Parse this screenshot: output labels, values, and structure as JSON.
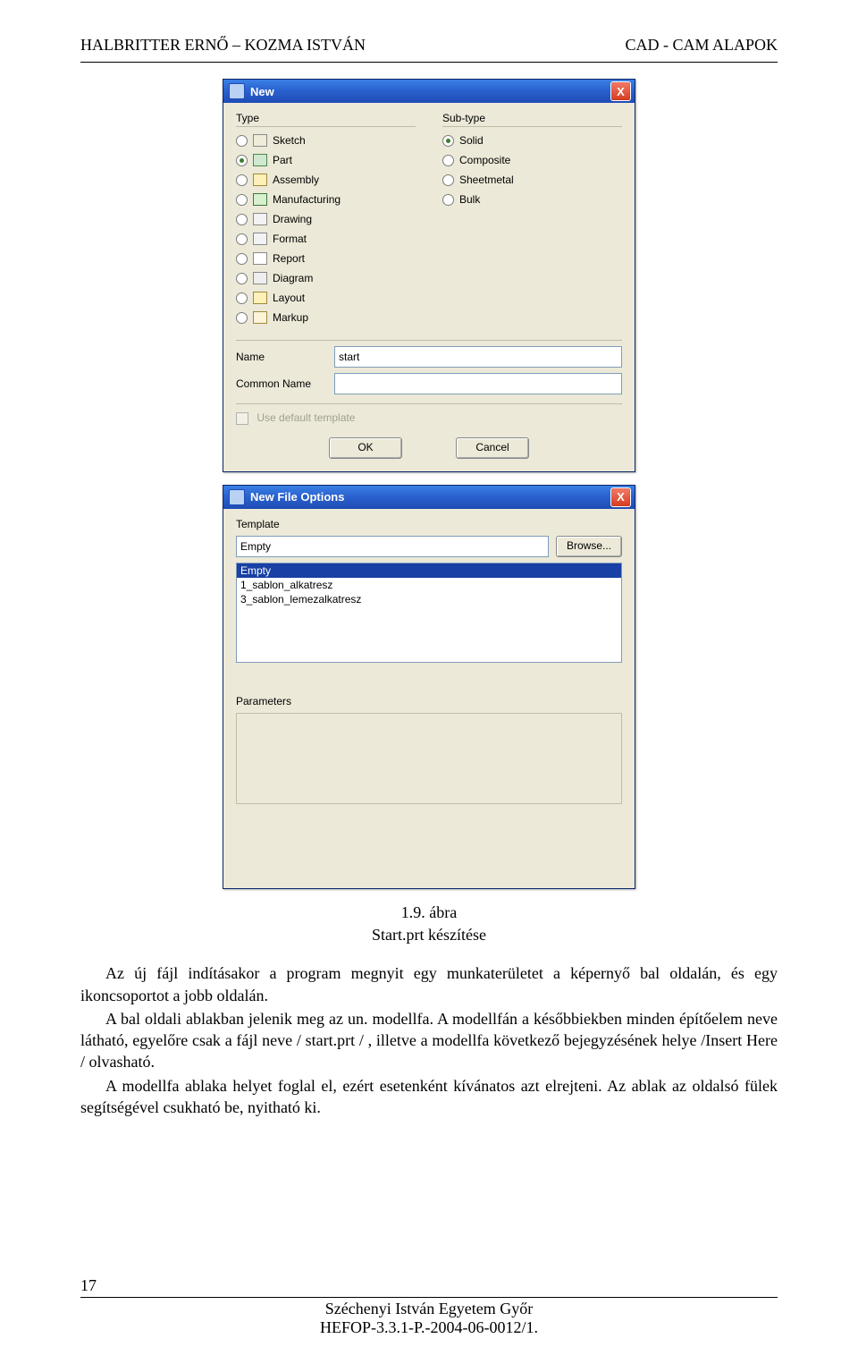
{
  "header": {
    "left": "HALBRITTER ERNŐ – KOZMA ISTVÁN",
    "right": "CAD - CAM ALAPOK"
  },
  "dialog_new": {
    "title": "New",
    "close": "X",
    "type_section": "Type",
    "subtype_section": "Sub-type",
    "types": [
      {
        "label": "Sketch",
        "icon": "sketch",
        "checked": false
      },
      {
        "label": "Part",
        "icon": "part",
        "checked": true
      },
      {
        "label": "Assembly",
        "icon": "asm",
        "checked": false
      },
      {
        "label": "Manufacturing",
        "icon": "mfg",
        "checked": false
      },
      {
        "label": "Drawing",
        "icon": "drw",
        "checked": false
      },
      {
        "label": "Format",
        "icon": "fmt",
        "checked": false
      },
      {
        "label": "Report",
        "icon": "rpt",
        "checked": false
      },
      {
        "label": "Diagram",
        "icon": "dgm",
        "checked": false
      },
      {
        "label": "Layout",
        "icon": "lyt",
        "checked": false
      },
      {
        "label": "Markup",
        "icon": "mkp",
        "checked": false
      }
    ],
    "subtypes": [
      {
        "label": "Solid",
        "checked": true
      },
      {
        "label": "Composite",
        "checked": false
      },
      {
        "label": "Sheetmetal",
        "checked": false
      },
      {
        "label": "Bulk",
        "checked": false
      }
    ],
    "name_label": "Name",
    "name_value": "start",
    "common_name_label": "Common Name",
    "common_name_value": "",
    "default_template": "Use default template",
    "ok": "OK",
    "cancel": "Cancel"
  },
  "dialog_options": {
    "title": "New File Options",
    "close": "X",
    "template_label": "Template",
    "template_value": "Empty",
    "browse": "Browse...",
    "list": [
      "Empty",
      "1_sablon_alkatresz",
      "3_sablon_lemezalkatresz"
    ],
    "selected_index": 0,
    "parameters_label": "Parameters"
  },
  "caption": {
    "line1": "1.9. ábra",
    "line2": "Start.prt készítése"
  },
  "body": {
    "p1": "Az új fájl indításakor a program megnyit egy munkaterületet a képernyő bal oldalán, és egy ikoncsoportot a jobb oldalán.",
    "p2": "A bal oldali ablakban jelenik meg az un. modellfa. A modellfán a későbbiekben minden építőelem neve látható, egyelőre csak a fájl neve / start.prt / , illetve a modellfa következő bejegyzésének helye /Insert Here / olvasható.",
    "p3": "A modellfa ablaka helyet foglal el, ezért esetenként kívánatos azt elrejteni. Az ablak az oldalsó fülek segítségével csukható be, nyitható ki."
  },
  "footer": {
    "page": "17",
    "uni": "Széchenyi István Egyetem Győr",
    "proj": "HEFOP-3.3.1-P.-2004-06-0012/1."
  }
}
